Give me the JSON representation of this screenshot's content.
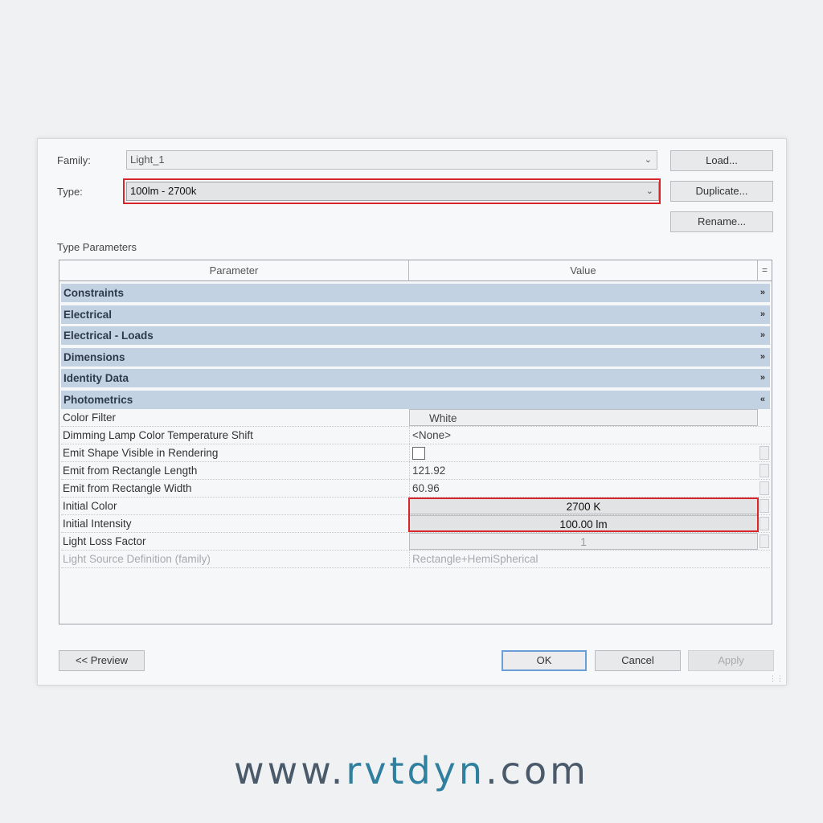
{
  "dialog": {
    "family_label": "Family:",
    "family_value": "Light_1",
    "type_label": "Type:",
    "type_value": "100lm - 2700k",
    "buttons": {
      "load": "Load...",
      "duplicate": "Duplicate...",
      "rename": "Rename..."
    },
    "section_title": "Type Parameters",
    "table": {
      "col_parameter": "Parameter",
      "col_value": "Value",
      "col_extra": "="
    },
    "groups": [
      {
        "label": "Constraints",
        "toggle": "»"
      },
      {
        "label": "Electrical",
        "toggle": "»"
      },
      {
        "label": "Electrical - Loads",
        "toggle": "»"
      },
      {
        "label": "Dimensions",
        "toggle": "»"
      },
      {
        "label": "Identity Data",
        "toggle": "»"
      },
      {
        "label": "Photometrics",
        "toggle": "«"
      }
    ],
    "rows": [
      {
        "name": "Color Filter",
        "value": "White"
      },
      {
        "name": "Dimming Lamp Color Temperature Shift",
        "value": "<None>"
      },
      {
        "name": "Emit Shape Visible in Rendering",
        "value": ""
      },
      {
        "name": "Emit from Rectangle Length",
        "value": "121.92"
      },
      {
        "name": "Emit from Rectangle Width",
        "value": "60.96"
      },
      {
        "name": "Initial Color",
        "value": "2700 K"
      },
      {
        "name": "Initial Intensity",
        "value": "100.00 lm"
      },
      {
        "name": "Light Loss Factor",
        "value": "1"
      },
      {
        "name": "Light Source Definition (family)",
        "value": "Rectangle+HemiSpherical"
      }
    ],
    "footer": {
      "preview": "<< Preview",
      "ok": "OK",
      "cancel": "Cancel",
      "apply": "Apply"
    }
  },
  "watermark": {
    "prefix": "www.",
    "brand": "rvtdyn",
    "suffix": ".com"
  },
  "colors": {
    "highlight": "#d6262b",
    "group_header": "#c2d2e3",
    "ok_border": "#6b9ed6",
    "brand": "#2f7f9e"
  }
}
